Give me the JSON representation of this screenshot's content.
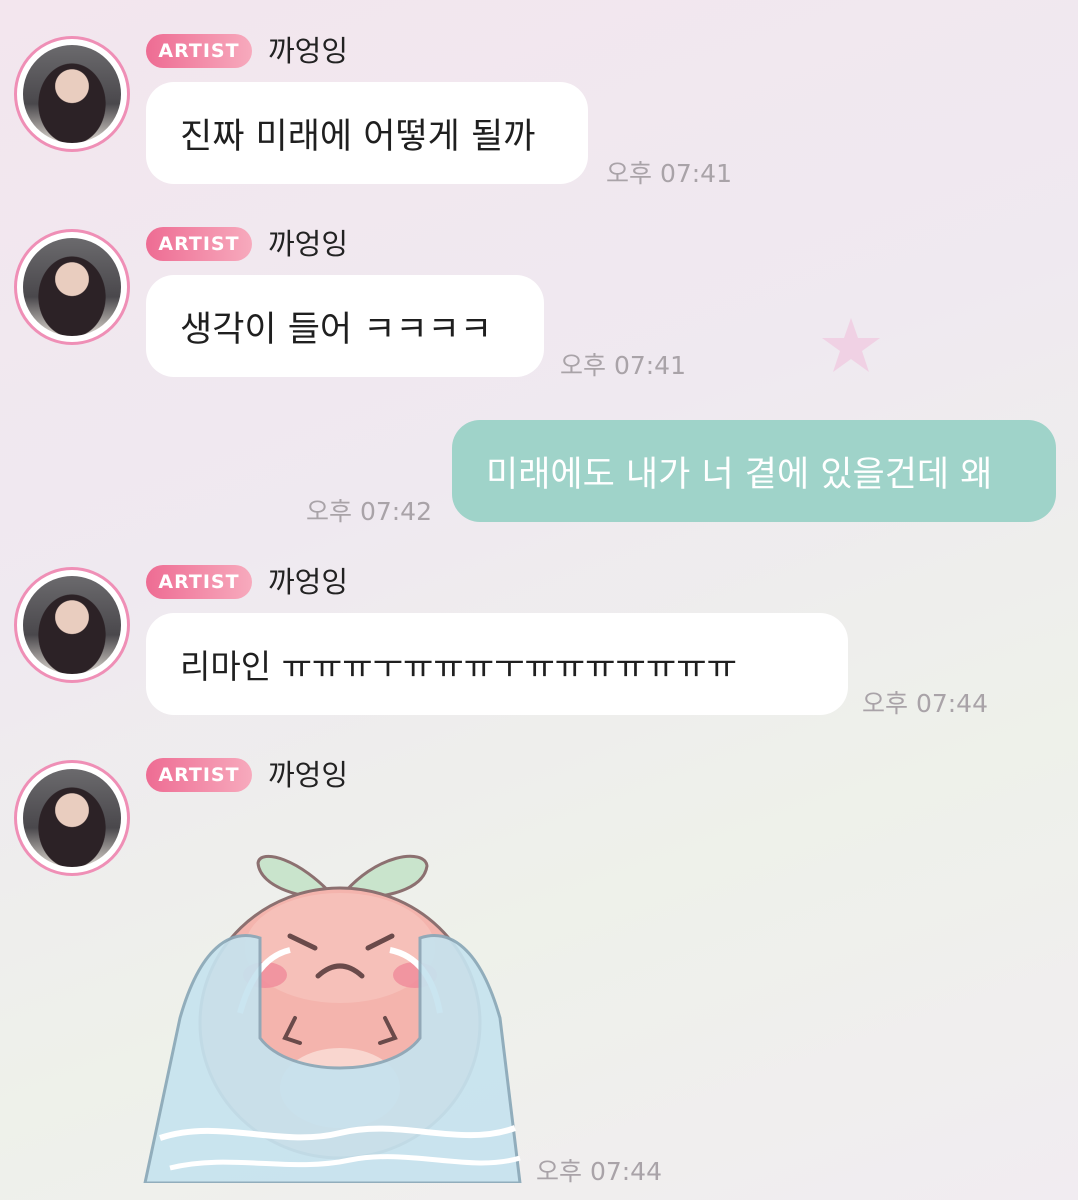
{
  "messages": [
    {
      "badge": "ARTIST",
      "sender": "까엉잉",
      "text": "진짜 미래에 어떻게 될까",
      "time": "오후 07:41"
    },
    {
      "badge": "ARTIST",
      "sender": "까엉잉",
      "text": "생각이 들어 ㅋㅋㅋㅋ",
      "time": "오후 07:41"
    },
    {
      "text": "미래에도 내가 너 곁에 있을건데 왜",
      "time": "오후 07:42"
    },
    {
      "badge": "ARTIST",
      "sender": "까엉잉",
      "text": "리마인 ㅠㅠㅠㅜㅠㅠㅠㅜㅠㅠㅠㅠㅠㅠㅠ",
      "time": "오후 07:44"
    },
    {
      "badge": "ARTIST",
      "sender": "까엉잉",
      "sticker": "crying-peach-sticker",
      "time": "오후 07:44"
    }
  ],
  "colors": {
    "badge": "#ee6c93",
    "avatar_ring": "#ef8fb6",
    "mine_bubble": "#9fd3c9",
    "other_bubble": "#ffffff"
  }
}
